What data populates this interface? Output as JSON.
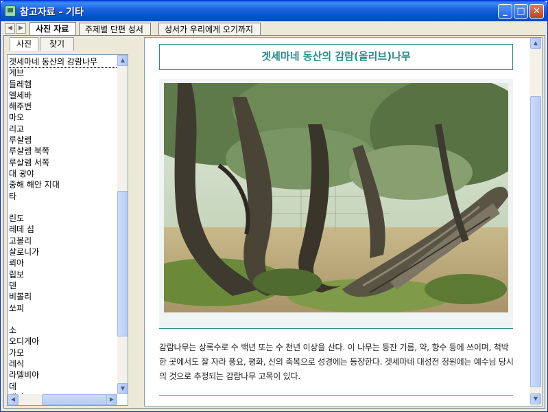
{
  "window": {
    "title": "참고자료 - 기타",
    "minimize_icon": "minimize-icon",
    "maximize_icon": "maximize-icon",
    "close_icon": "close-icon"
  },
  "tabs": [
    {
      "label": "사진 자료",
      "active": true
    },
    {
      "label": "주제별 단편 성서",
      "active": false
    },
    {
      "label": "성서가 우리에게 오기까지",
      "active": false
    }
  ],
  "side_tabs": [
    {
      "label": "사진",
      "active": true
    },
    {
      "label": "찾기",
      "active": false
    }
  ],
  "places": [
    "겟세마네 동산의 감람나무",
    "게브",
    "들레헴",
    "엘세바",
    "해주변",
    "마오",
    "리고",
    "루살렘",
    "루살렘 북쪽",
    "루살렘 서쪽",
    "대 광야",
    "중해 해안 지대",
    "타",
    "",
    "린도",
    "레데 섬",
    "고볼리",
    "살로니가",
    "뢰아",
    "립보",
    "덴",
    "비볼리",
    "쏘피",
    "",
    "소",
    "오디게아",
    "가모",
    "레식",
    "라델비아",
    "데",
    "대나"
  ],
  "content": {
    "title": "겟세마네 동산의 감람(올리브)나무",
    "caption": "감람나무는 상록수로 수 백년 또는 수 천년 이상을 산다. 이 나무는 등잔 기름, 약, 향수 등에 쓰이며, 척박한 곳에서도 잘 자라 풍요, 평화, 신의 축복으로 성경에는 등장한다. 겟세마네 대성전 정원에는 예수님 당시의 것으로 추정되는 감람나무 고목이 있다."
  },
  "colors": {
    "accent": "#2a8a86",
    "titlebar": "#0052cc"
  }
}
